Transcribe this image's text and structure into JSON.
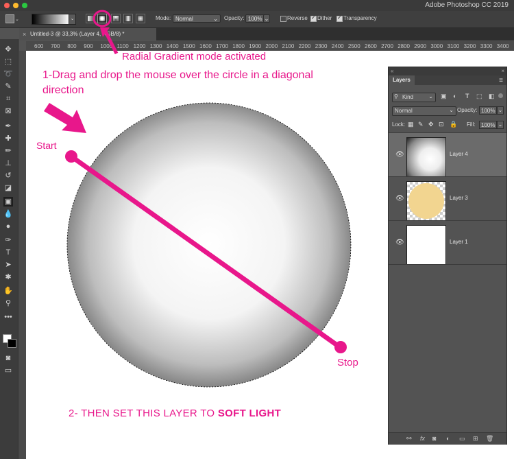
{
  "window": {
    "title": "Adobe Photoshop CC 2019"
  },
  "options_bar": {
    "mode_label": "Mode:",
    "mode_value": "Normal",
    "opacity_label": "Opacity:",
    "opacity_value": "100%",
    "reverse_label": "Reverse",
    "reverse_checked": false,
    "dither_label": "Dither",
    "dither_checked": true,
    "transparency_label": "Transparency",
    "transparency_checked": true
  },
  "document": {
    "tab_title": "Untitled-3 @ 33,3% (Layer 4, RGB/8) *"
  },
  "ruler": {
    "ticks": [
      "600",
      "700",
      "800",
      "900",
      "1000",
      "1100",
      "1200",
      "1300",
      "1400",
      "1500",
      "1600",
      "1700",
      "1800",
      "1900",
      "2000",
      "2100",
      "2200",
      "2300",
      "2400",
      "2500",
      "2600",
      "2700",
      "2800",
      "2900",
      "3000",
      "3100",
      "3200",
      "3300",
      "3400"
    ]
  },
  "annotations": {
    "radial_note": "Radial Gradient mode activated",
    "step1": "1-Drag and drop the mouse over the circle in a diagonal direction",
    "start": "Start",
    "stop": "Stop",
    "step2_prefix": "2- THEN SET THIS LAYER TO ",
    "step2_bold": "SOFT LIGHT",
    "color": "#e8178b"
  },
  "layers_panel": {
    "tab_label": "Layers",
    "filter_label": "Kind",
    "blend_mode": "Normal",
    "opacity_label": "Opacity:",
    "opacity_value": "100%",
    "lock_label": "Lock:",
    "fill_label": "Fill:",
    "fill_value": "100%",
    "footer_icons": [
      "link-icon",
      "fx-icon",
      "mask-icon",
      "adjustment-icon",
      "folder-icon",
      "new-layer-icon",
      "trash-icon"
    ],
    "layers": [
      {
        "name": "Layer 4",
        "selected": true,
        "thumb": "gradient"
      },
      {
        "name": "Layer 3",
        "selected": false,
        "thumb": "circle",
        "thumb_color": "#f2d590"
      },
      {
        "name": "Layer 1",
        "selected": false,
        "thumb": "white"
      }
    ]
  }
}
